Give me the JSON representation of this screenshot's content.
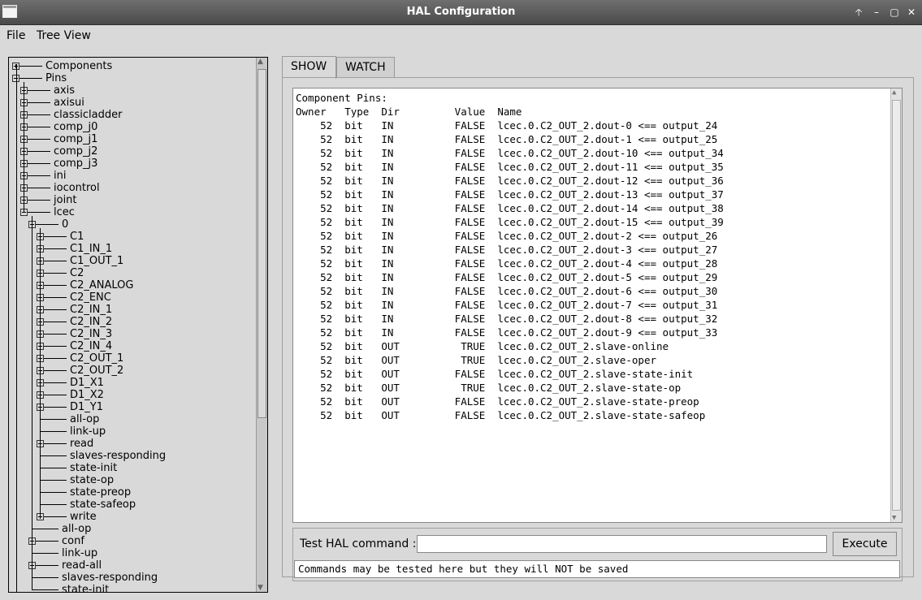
{
  "window": {
    "title": "HAL Configuration",
    "controls": [
      "🡡",
      "–",
      "▢",
      "✕"
    ]
  },
  "menu": {
    "items": [
      "File",
      "Tree View"
    ]
  },
  "tree": {
    "items": [
      {
        "label": "Components",
        "level": 0,
        "expander": "plus"
      },
      {
        "label": "Pins",
        "level": 0,
        "expander": "minus"
      },
      {
        "label": "axis",
        "level": 1,
        "expander": "plus"
      },
      {
        "label": "axisui",
        "level": 1,
        "expander": "plus"
      },
      {
        "label": "classicladder",
        "level": 1,
        "expander": "plus"
      },
      {
        "label": "comp_j0",
        "level": 1,
        "expander": "plus"
      },
      {
        "label": "comp_j1",
        "level": 1,
        "expander": "plus"
      },
      {
        "label": "comp_j2",
        "level": 1,
        "expander": "plus"
      },
      {
        "label": "comp_j3",
        "level": 1,
        "expander": "plus"
      },
      {
        "label": "ini",
        "level": 1,
        "expander": "plus"
      },
      {
        "label": "iocontrol",
        "level": 1,
        "expander": "plus"
      },
      {
        "label": "joint",
        "level": 1,
        "expander": "plus"
      },
      {
        "label": "lcec",
        "level": 1,
        "expander": "minus"
      },
      {
        "label": "0",
        "level": 2,
        "expander": "minus"
      },
      {
        "label": "C1",
        "level": 3,
        "expander": "plus"
      },
      {
        "label": "C1_IN_1",
        "level": 3,
        "expander": "plus"
      },
      {
        "label": "C1_OUT_1",
        "level": 3,
        "expander": "plus"
      },
      {
        "label": "C2",
        "level": 3,
        "expander": "plus"
      },
      {
        "label": "C2_ANALOG",
        "level": 3,
        "expander": "plus"
      },
      {
        "label": "C2_ENC",
        "level": 3,
        "expander": "plus"
      },
      {
        "label": "C2_IN_1",
        "level": 3,
        "expander": "plus"
      },
      {
        "label": "C2_IN_2",
        "level": 3,
        "expander": "plus"
      },
      {
        "label": "C2_IN_3",
        "level": 3,
        "expander": "plus"
      },
      {
        "label": "C2_IN_4",
        "level": 3,
        "expander": "plus"
      },
      {
        "label": "C2_OUT_1",
        "level": 3,
        "expander": "plus"
      },
      {
        "label": "C2_OUT_2",
        "level": 3,
        "expander": "plus"
      },
      {
        "label": "D1_X1",
        "level": 3,
        "expander": "plus"
      },
      {
        "label": "D1_X2",
        "level": 3,
        "expander": "plus"
      },
      {
        "label": "D1_Y1",
        "level": 3,
        "expander": "plus"
      },
      {
        "label": "all-op",
        "level": 3,
        "expander": "none"
      },
      {
        "label": "link-up",
        "level": 3,
        "expander": "none"
      },
      {
        "label": "read",
        "level": 3,
        "expander": "plus"
      },
      {
        "label": "slaves-responding",
        "level": 3,
        "expander": "none"
      },
      {
        "label": "state-init",
        "level": 3,
        "expander": "none"
      },
      {
        "label": "state-op",
        "level": 3,
        "expander": "none"
      },
      {
        "label": "state-preop",
        "level": 3,
        "expander": "none"
      },
      {
        "label": "state-safeop",
        "level": 3,
        "expander": "none"
      },
      {
        "label": "write",
        "level": 3,
        "expander": "plus"
      },
      {
        "label": "all-op",
        "level": 2,
        "expander": "none"
      },
      {
        "label": "conf",
        "level": 2,
        "expander": "plus"
      },
      {
        "label": "link-up",
        "level": 2,
        "expander": "none"
      },
      {
        "label": "read-all",
        "level": 2,
        "expander": "plus"
      },
      {
        "label": "slaves-responding",
        "level": 2,
        "expander": "none"
      },
      {
        "label": "state-init",
        "level": 2,
        "expander": "none"
      }
    ]
  },
  "tabs": [
    {
      "label": "SHOW",
      "active": true
    },
    {
      "label": "WATCH",
      "active": false
    }
  ],
  "output": {
    "lines": [
      "Component Pins:",
      "Owner   Type  Dir         Value  Name",
      "    52  bit   IN          FALSE  lcec.0.C2_OUT_2.dout-0 <== output_24",
      "    52  bit   IN          FALSE  lcec.0.C2_OUT_2.dout-1 <== output_25",
      "    52  bit   IN          FALSE  lcec.0.C2_OUT_2.dout-10 <== output_34",
      "    52  bit   IN          FALSE  lcec.0.C2_OUT_2.dout-11 <== output_35",
      "    52  bit   IN          FALSE  lcec.0.C2_OUT_2.dout-12 <== output_36",
      "    52  bit   IN          FALSE  lcec.0.C2_OUT_2.dout-13 <== output_37",
      "    52  bit   IN          FALSE  lcec.0.C2_OUT_2.dout-14 <== output_38",
      "    52  bit   IN          FALSE  lcec.0.C2_OUT_2.dout-15 <== output_39",
      "    52  bit   IN          FALSE  lcec.0.C2_OUT_2.dout-2 <== output_26",
      "    52  bit   IN          FALSE  lcec.0.C2_OUT_2.dout-3 <== output_27",
      "    52  bit   IN          FALSE  lcec.0.C2_OUT_2.dout-4 <== output_28",
      "    52  bit   IN          FALSE  lcec.0.C2_OUT_2.dout-5 <== output_29",
      "    52  bit   IN          FALSE  lcec.0.C2_OUT_2.dout-6 <== output_30",
      "    52  bit   IN          FALSE  lcec.0.C2_OUT_2.dout-7 <== output_31",
      "    52  bit   IN          FALSE  lcec.0.C2_OUT_2.dout-8 <== output_32",
      "    52  bit   IN          FALSE  lcec.0.C2_OUT_2.dout-9 <== output_33",
      "    52  bit   OUT          TRUE  lcec.0.C2_OUT_2.slave-online",
      "    52  bit   OUT          TRUE  lcec.0.C2_OUT_2.slave-oper",
      "    52  bit   OUT         FALSE  lcec.0.C2_OUT_2.slave-state-init",
      "    52  bit   OUT          TRUE  lcec.0.C2_OUT_2.slave-state-op",
      "    52  bit   OUT         FALSE  lcec.0.C2_OUT_2.slave-state-preop",
      "    52  bit   OUT         FALSE  lcec.0.C2_OUT_2.slave-state-safeop"
    ]
  },
  "command": {
    "label": "Test HAL command :",
    "value": "",
    "execute_label": "Execute",
    "note": "Commands may be tested here but they will NOT be saved"
  }
}
